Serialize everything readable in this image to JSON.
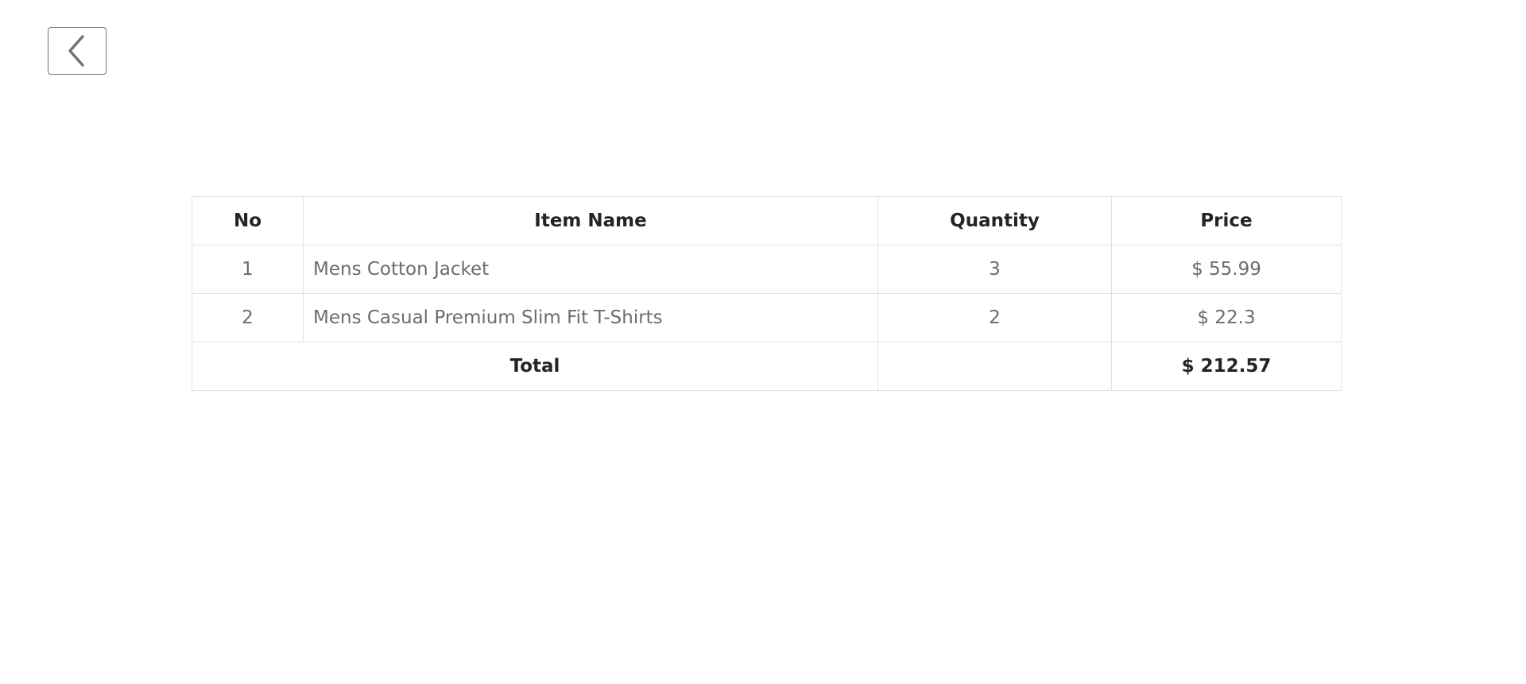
{
  "header": {
    "back_icon": "chevron-left-icon"
  },
  "table": {
    "columns": [
      "No",
      "Item Name",
      "Quantity",
      "Price"
    ],
    "rows": [
      {
        "no": "1",
        "name": "Mens Cotton Jacket",
        "quantity": "3",
        "price": "$ 55.99"
      },
      {
        "no": "2",
        "name": "Mens Casual Premium Slim Fit T-Shirts",
        "quantity": "2",
        "price": "$ 22.3"
      }
    ],
    "total": {
      "label": "Total",
      "quantity": "",
      "price": "$ 212.57"
    }
  },
  "colors": {
    "border": "#dee2e6",
    "heading_text": "#212529",
    "cell_text": "#6c6c6c",
    "back_button_border": "#6c757d"
  }
}
